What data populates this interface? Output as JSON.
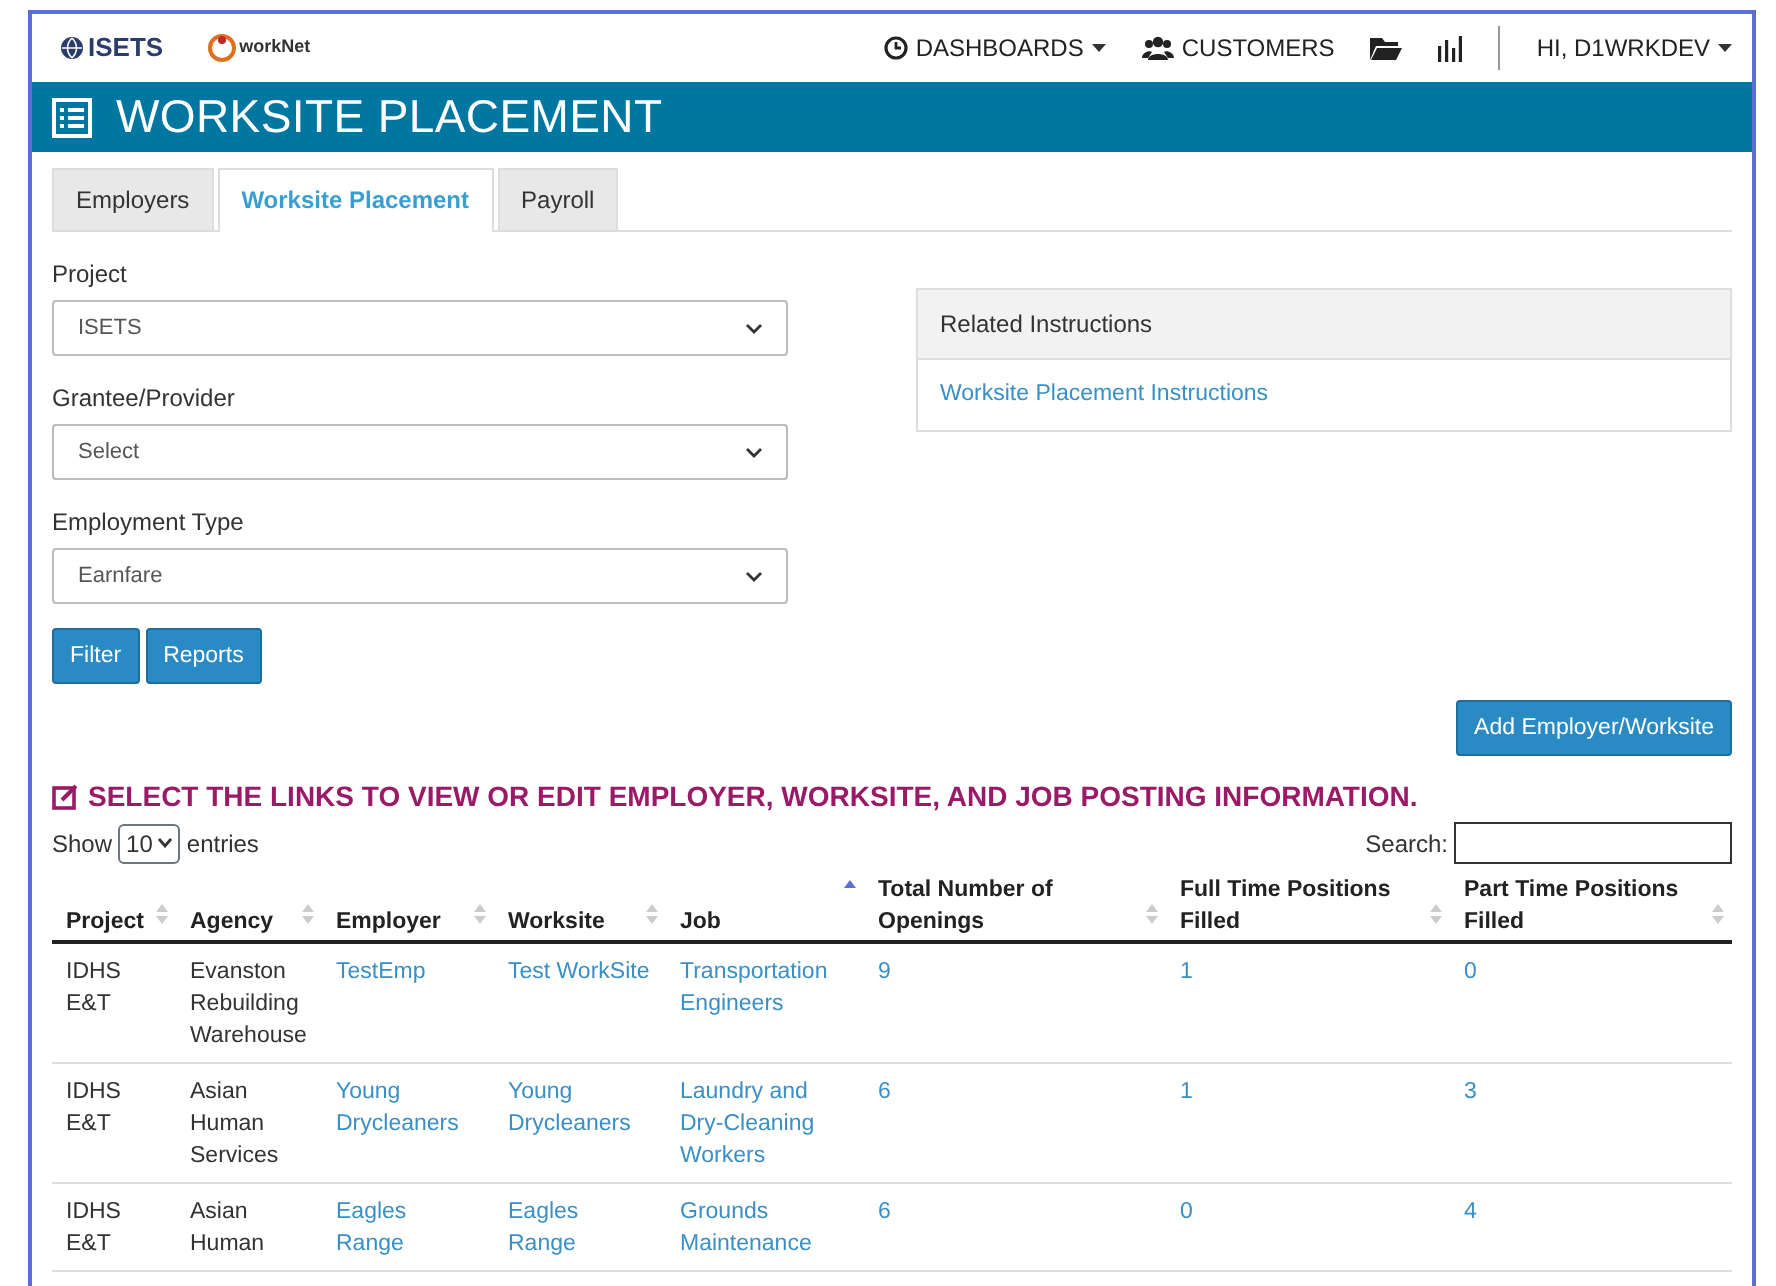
{
  "header": {
    "logo": "ISETS",
    "partner_logo": "workNet",
    "nav": [
      {
        "kind": "dropdown",
        "label": "DASHBOARDS"
      },
      {
        "kind": "link",
        "label": "CUSTOMERS"
      },
      {
        "kind": "icon"
      },
      {
        "kind": "icon"
      },
      {
        "kind": "dropdown",
        "label": "HI, D1WRKDEV"
      }
    ]
  },
  "banner": {
    "title": "WORKSITE PLACEMENT"
  },
  "tabs": [
    {
      "label": "Employers",
      "selected": false
    },
    {
      "label": "Worksite Placement",
      "selected": true
    },
    {
      "label": "Payroll",
      "selected": false
    }
  ],
  "filters": [
    {
      "label": "Project",
      "value": "ISETS"
    },
    {
      "label": "Grantee/Provider",
      "value": "Select"
    },
    {
      "label": "Employment Type",
      "value": "Earnfare"
    }
  ],
  "buttons": [
    "Filter",
    "Reports"
  ],
  "related": {
    "title": "Related Instructions",
    "links": [
      "Worksite Placement Instructions"
    ]
  },
  "add_button": "Add Employer/Worksite",
  "instructions": "SELECT THE LINKS TO VIEW OR EDIT EMPLOYER, WORKSITE, AND JOB POSTING INFORMATION.",
  "table_controls": {
    "show_label": "Show",
    "page_size": "10",
    "entries_label": "entries",
    "search_label": "Search:"
  },
  "table": {
    "columns": [
      {
        "label": "Project",
        "sorted": false
      },
      {
        "label": "Agency",
        "sorted": false
      },
      {
        "label": "Employer",
        "sorted": false
      },
      {
        "label": "Worksite",
        "sorted": false
      },
      {
        "label": "Job",
        "sorted": true
      },
      {
        "label": "Total Number of Openings",
        "sorted": false
      },
      {
        "label": "Full Time Positions Filled",
        "sorted": false
      },
      {
        "label": "Part Time Positions Filled",
        "sorted": false
      }
    ],
    "rows": [
      [
        "IDHS E&T",
        "Evanston Rebuilding Warehouse",
        "TestEmp",
        "Test WorkSite",
        "Transportation Engineers",
        "9",
        "1",
        "0"
      ],
      [
        "IDHS E&T",
        "Asian Human Services",
        "Young Drycleaners",
        "Young Drycleaners",
        "Laundry and Dry-Cleaning Workers",
        "6",
        "1",
        "3"
      ],
      [
        "IDHS E&T",
        "Asian Human",
        "Eagles Range",
        "Eagles Range",
        "Grounds Maintenance",
        "6",
        "0",
        "4"
      ]
    ]
  }
}
